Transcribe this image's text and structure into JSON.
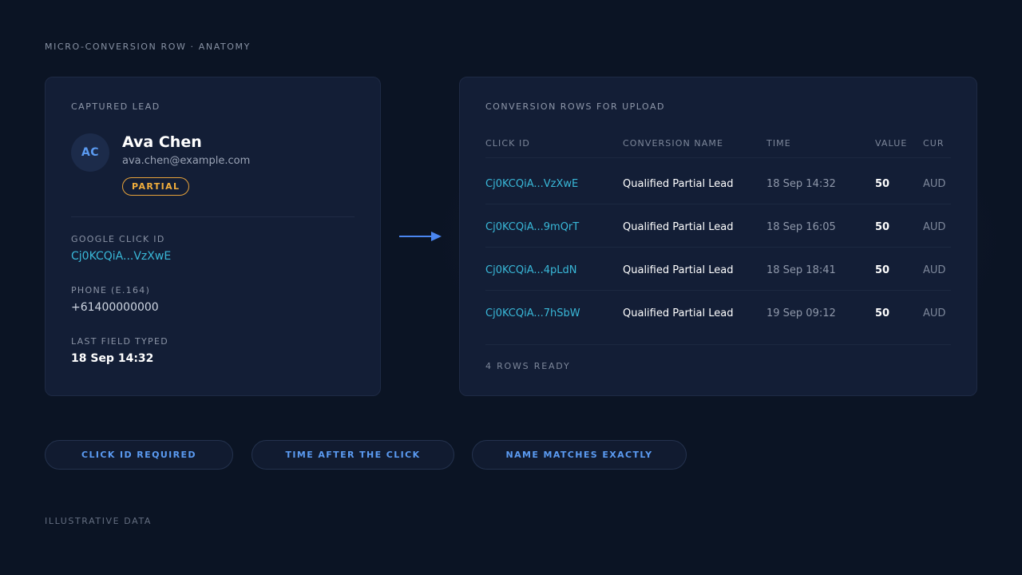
{
  "eyebrow": "MICRO-CONVERSION ROW · ANATOMY",
  "lead": {
    "heading": "CAPTURED LEAD",
    "initials": "AC",
    "name": "Ava Chen",
    "email": "ava.chen@example.com",
    "status": "PARTIAL",
    "fields": [
      {
        "label": "GOOGLE CLICK ID",
        "value": "Cj0KCQiA...VzXwE"
      },
      {
        "label": "PHONE (E.164)",
        "value": "+61400000000"
      },
      {
        "label": "LAST FIELD TYPED",
        "value": "18 Sep 14:32"
      }
    ]
  },
  "upload": {
    "heading": "CONVERSION ROWS FOR UPLOAD",
    "columns": [
      "CLICK ID",
      "CONVERSION NAME",
      "TIME",
      "VALUE",
      "CUR"
    ],
    "rows": [
      {
        "click_id": "Cj0KCQiA...VzXwE",
        "name": "Qualified Partial Lead",
        "time": "18 Sep 14:32",
        "value": "50",
        "currency": "AUD"
      },
      {
        "click_id": "Cj0KCQiA...9mQrT",
        "name": "Qualified Partial Lead",
        "time": "18 Sep 16:05",
        "value": "50",
        "currency": "AUD"
      },
      {
        "click_id": "Cj0KCQiA...4pLdN",
        "name": "Qualified Partial Lead",
        "time": "18 Sep 18:41",
        "value": "50",
        "currency": "AUD"
      },
      {
        "click_id": "Cj0KCQiA...7hSbW",
        "name": "Qualified Partial Lead",
        "time": "19 Sep 09:12",
        "value": "50",
        "currency": "AUD"
      }
    ],
    "footer": "4 ROWS READY"
  },
  "rules": [
    "CLICK ID REQUIRED",
    "TIME AFTER THE CLICK",
    "NAME MATCHES EXACTLY"
  ],
  "footnote": "ILLUSTRATIVE DATA",
  "colors": {
    "background": "#0b1424",
    "card": "#131e36",
    "accent_blue": "#5b9bf2",
    "click_id_cyan": "#39b8d8",
    "partial_badge": "#f0ad3c"
  },
  "icons": {
    "flow": "arrow-right-icon"
  }
}
